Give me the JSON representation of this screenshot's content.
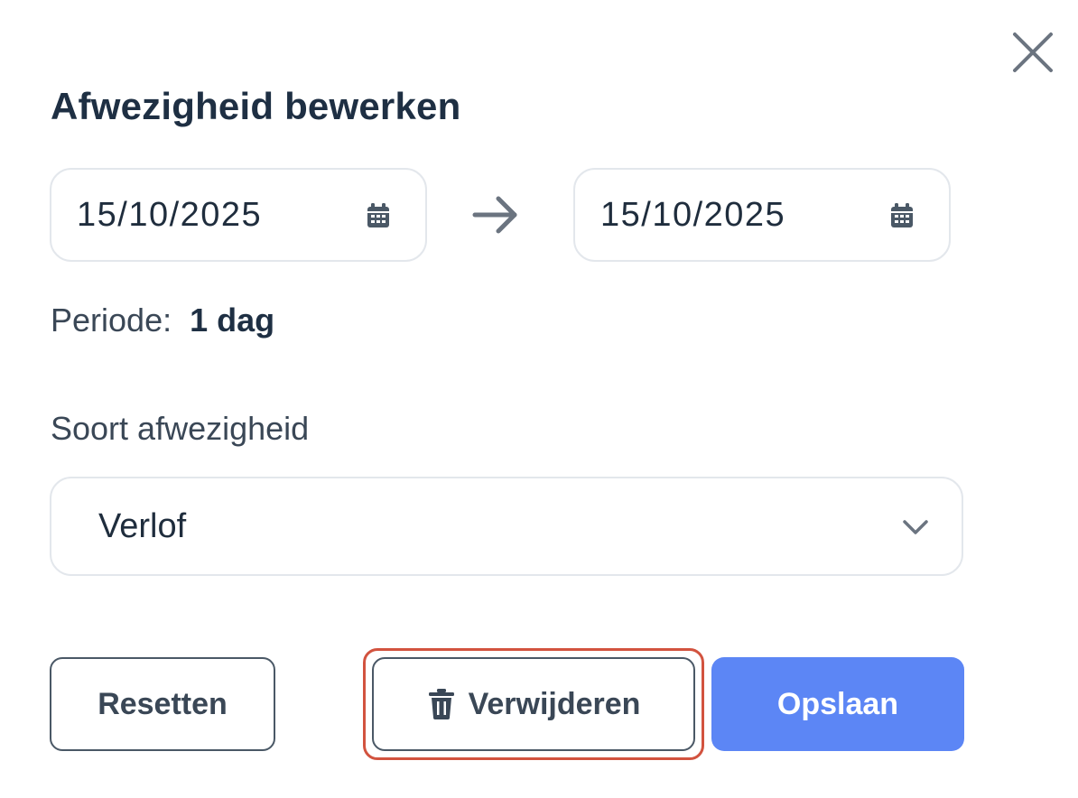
{
  "dialog": {
    "title": "Afwezigheid bewerken",
    "close_icon": "close-icon"
  },
  "dates": {
    "start": "15/10/2025",
    "end": "15/10/2025",
    "calendar_icon": "calendar-icon",
    "separator_icon": "arrow-right-icon"
  },
  "period": {
    "label": "Periode:",
    "value": "1 dag"
  },
  "absence_type": {
    "label": "Soort afwezigheid",
    "selected": "Verlof",
    "dropdown_icon": "chevron-down-icon"
  },
  "actions": {
    "reset_label": "Resetten",
    "delete_label": "Verwijderen",
    "delete_icon": "trash-icon",
    "save_label": "Opslaan"
  },
  "colors": {
    "primary": "#5c86f5",
    "highlight": "#d2533f",
    "text_dark": "#1e2f43",
    "border": "#e3e7ec"
  }
}
